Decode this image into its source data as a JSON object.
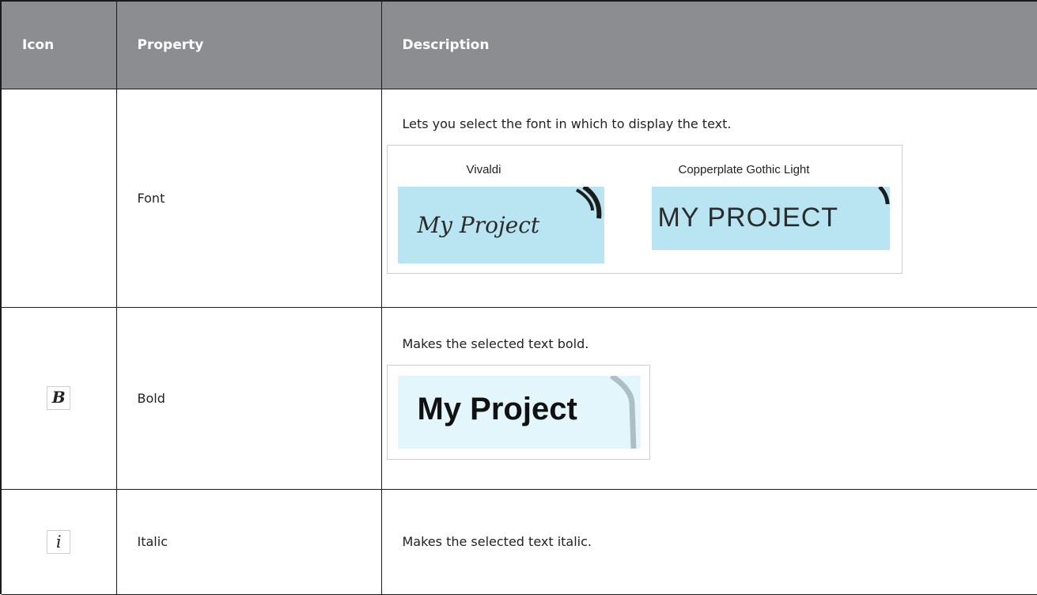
{
  "table": {
    "headers": {
      "icon": "Icon",
      "property": "Property",
      "description": "Description"
    },
    "rows": [
      {
        "icon": "",
        "property": "Font",
        "description": "Lets you select the font in which to display the text.",
        "samples": [
          {
            "label": "Vivaldi",
            "text": "My Project"
          },
          {
            "label": "Copperplate Gothic Light",
            "text": "MY PROJECT"
          }
        ]
      },
      {
        "icon": "bold-icon",
        "icon_glyph": "B",
        "property": "Bold",
        "description": "Makes the selected text bold.",
        "sample_text": "My Project"
      },
      {
        "icon": "italic-icon",
        "icon_glyph": "i",
        "property": "Italic",
        "description": "Makes the selected text italic."
      }
    ]
  },
  "colors": {
    "header_bg": "#8c8d91",
    "swatch_bg": "#b8e5f1",
    "swatch_bg_light": "#e3f6fb",
    "border": "#1b1b1b"
  }
}
